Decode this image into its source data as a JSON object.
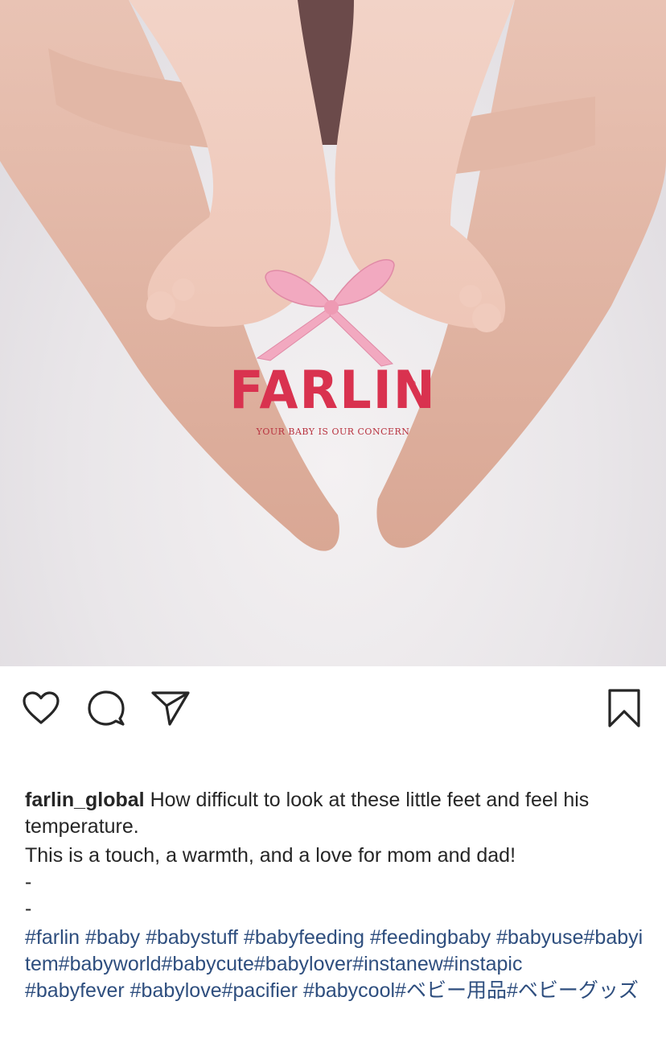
{
  "photo": {
    "logo_brand": "FARLIN",
    "logo_registered": "®",
    "logo_tagline": "YOUR BABY IS OUR CONCERN"
  },
  "actions": {
    "like_icon": "heart-icon",
    "comment_icon": "comment-icon",
    "share_icon": "send-icon",
    "save_icon": "bookmark-icon"
  },
  "caption": {
    "username": "farlin_global",
    "text_line_1": "How difficult to look at these little feet and feel his temperature.",
    "text_line_2": "This is a touch, a warmth, and a love for mom and dad!",
    "separator_1": "-",
    "separator_2": "-",
    "hashtags_line_1": "#farlin #baby #babystuff #babyfeeding #feedingbaby #babyuse#babyitem#babyworld#babycute#babylover#instanew#instapic",
    "hashtags_line_2": "#babyfever #babylove#pacifier #babycool#ベビー用品#ベビーグッズ"
  },
  "colors": {
    "hashtag": "#2e4e7e",
    "text": "#262626",
    "brand": "#d9324f"
  }
}
